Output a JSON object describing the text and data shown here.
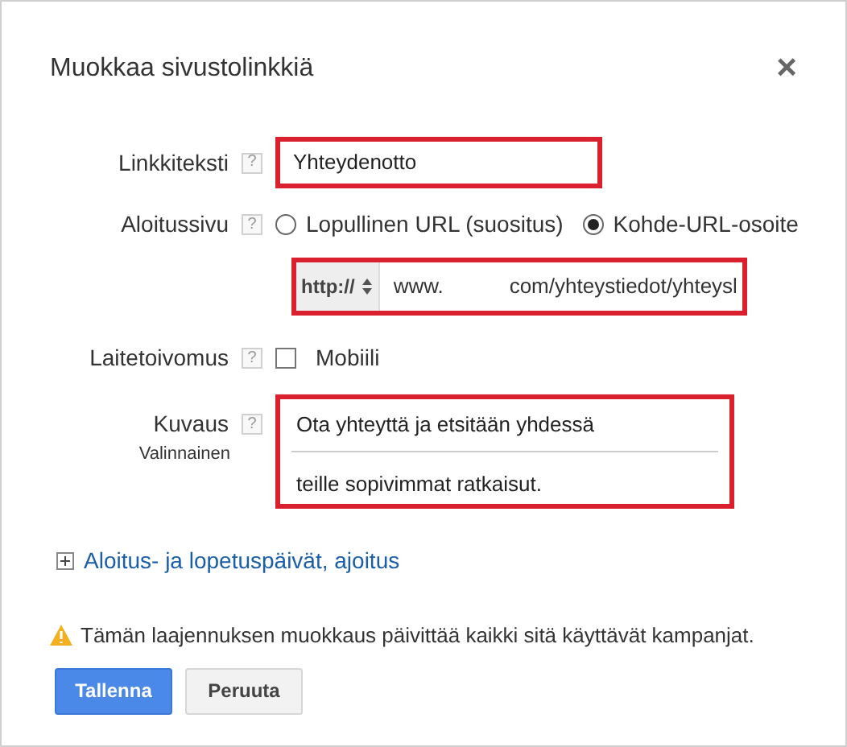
{
  "dialog": {
    "title": "Muokkaa sivustolinkkiä",
    "close": "×"
  },
  "link_text": {
    "label": "Linkkiteksti",
    "help": "?",
    "value": "Yhteydenotto",
    "highlighted": true
  },
  "landing_page": {
    "label": "Aloitussivu",
    "help": "?",
    "options": [
      {
        "label": "Lopullinen URL (suositus)",
        "selected": false
      },
      {
        "label": "Kohde-URL-osoite",
        "selected": true
      }
    ]
  },
  "url_field": {
    "protocol": "http://",
    "value_start": "www.",
    "value_end": "com/yhteystiedot/yhteysl",
    "highlighted": true
  },
  "device": {
    "label": "Laitetoivomus",
    "help": "?",
    "option": "Mobiili",
    "checked": false
  },
  "description": {
    "label": "Kuvaus",
    "help": "?",
    "sublabel": "Valinnainen",
    "lines": [
      "Ota yhteyttä ja etsitään yhdessä",
      "teille sopivimmat ratkaisut."
    ],
    "highlighted": true
  },
  "schedule": {
    "label": "Aloitus- ja lopetuspäivät, ajoitus",
    "expanded": false
  },
  "warning": "Tämän laajennuksen muokkaus päivittää kaikki sitä käyttävät kampanjat.",
  "buttons": [
    {
      "label": "Tallenna",
      "kind": "primary"
    },
    {
      "label": "Peruuta",
      "kind": "secondary"
    }
  ]
}
